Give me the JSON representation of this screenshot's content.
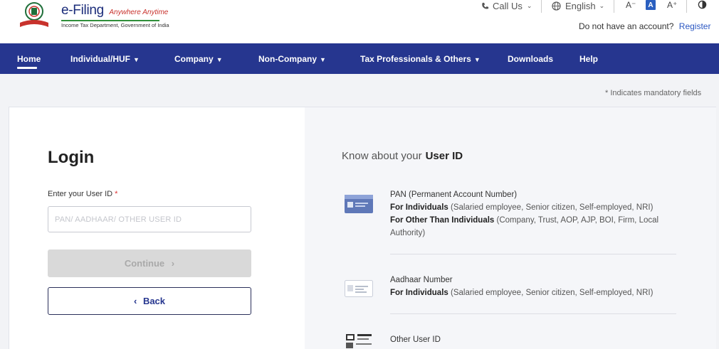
{
  "header": {
    "brand_title": "e-Filing",
    "brand_tagline": "Anywhere Anytime",
    "brand_subtitle": "Income Tax Department, Government of India",
    "call_us": "Call Us",
    "language": "English",
    "font_decrease": "A⁻",
    "font_normal": "A",
    "font_increase": "A⁺",
    "no_account_text": "Do not have an account?",
    "register_link": "Register"
  },
  "nav": {
    "items": [
      {
        "label": "Home"
      },
      {
        "label": "Individual/HUF"
      },
      {
        "label": "Company"
      },
      {
        "label": "Non-Company"
      },
      {
        "label": "Tax Professionals & Others"
      },
      {
        "label": "Downloads"
      },
      {
        "label": "Help"
      }
    ]
  },
  "mandatory_note": "* Indicates mandatory fields",
  "login": {
    "title": "Login",
    "field_label": "Enter your User ID",
    "required_mark": "*",
    "input_placeholder": "PAN/ AADHAAR/ OTHER USER ID",
    "input_value": "",
    "continue_label": "Continue",
    "back_label": "Back"
  },
  "know": {
    "title_prefix": "Know about your",
    "title_bold": "User ID",
    "items": [
      {
        "name": "PAN (Permanent Account Number)",
        "line1_bold": "For Individuals",
        "line1_text": "(Salaried employee, Senior citizen, Self-employed, NRI)",
        "line2_bold": "For Other Than Individuals",
        "line2_text": "(Company, Trust, AOP, AJP, BOI, Firm, Local Authority)"
      },
      {
        "name": "Aadhaar Number",
        "line1_bold": "For Individuals",
        "line1_text": "(Salaried employee, Senior citizen, Self-employed, NRI)"
      },
      {
        "name": "Other User ID"
      }
    ]
  },
  "colors": {
    "nav_bg": "#26368f",
    "link": "#2b57c2",
    "brand": "#1b2c7a"
  }
}
